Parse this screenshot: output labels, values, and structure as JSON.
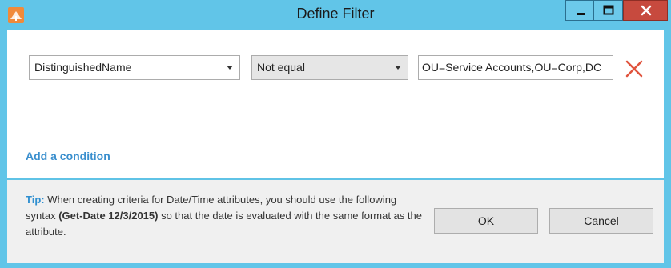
{
  "window": {
    "title": "Define Filter",
    "icon": "app-icon",
    "controls": [
      "minimize-icon",
      "maximize-icon",
      "close-icon"
    ]
  },
  "condition": {
    "attribute": "DistinguishedName",
    "operator": "Not equal",
    "value": "OU=Service Accounts,OU=Corp,DC",
    "remove_icon": "red-x-icon"
  },
  "add_condition_label": "Add a condition",
  "tip": {
    "label": "Tip:",
    "text_1": " When creating criteria for Date/Time attributes, you should use the following syntax ",
    "syntax": "(Get-Date 12/3/2015)",
    "text_2": " so that the date is evaluated with the same format as the attribute."
  },
  "buttons": {
    "ok": "OK",
    "cancel": "Cancel"
  },
  "colors": {
    "frame": "#61c5e8",
    "close_button": "#c74a3e",
    "link": "#3a8fce",
    "remove_icon": "#e0533d"
  }
}
